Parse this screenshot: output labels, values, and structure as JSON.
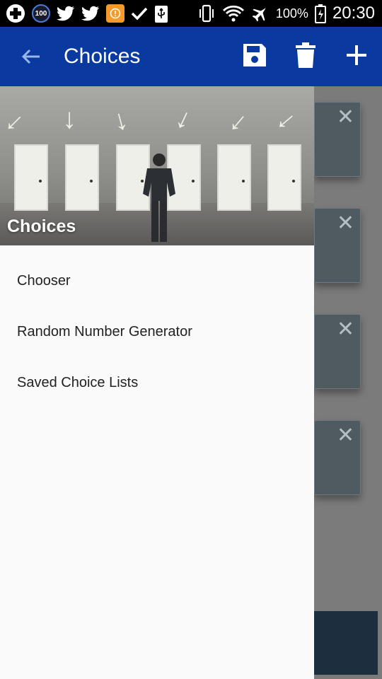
{
  "status_bar": {
    "badge": "100",
    "battery": "100%",
    "time": "20:30"
  },
  "app_bar": {
    "title": "Choices",
    "icons": [
      "back-arrow-icon",
      "save-icon",
      "delete-icon",
      "add-icon"
    ]
  },
  "drawer": {
    "header_title": "Choices",
    "items": [
      {
        "label": "Chooser"
      },
      {
        "label": "Random Number Generator"
      },
      {
        "label": "Saved Choice Lists"
      }
    ]
  },
  "colors": {
    "app_bar": "#0a3aa0",
    "drawer_bg": "#fafafa",
    "scrim": "#7b7b7b",
    "card": "#4f5a61"
  }
}
